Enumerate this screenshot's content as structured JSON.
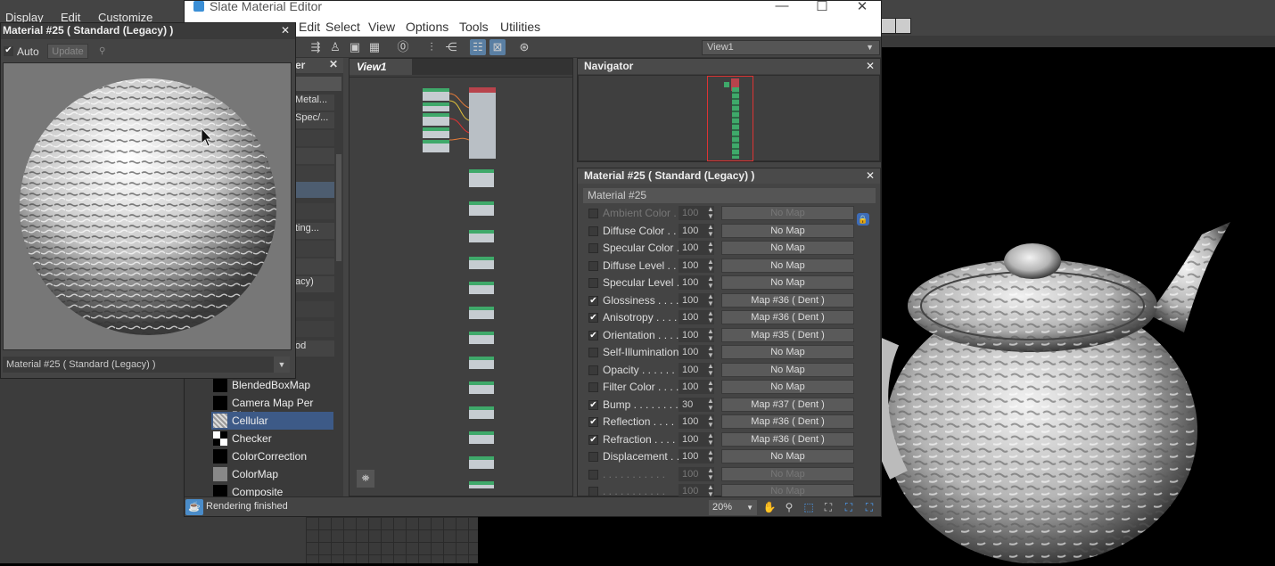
{
  "max": {
    "menu": [
      "Display",
      "Edit",
      "Customize"
    ]
  },
  "sme": {
    "title": "Slate Material Editor",
    "menu": [
      "Edit",
      "Select",
      "View",
      "Options",
      "Tools",
      "Utilities"
    ],
    "view_select": "View1",
    "browser": {
      "header": "er",
      "rows": [
        "Metal...",
        "Spec/...",
        "",
        "",
        "",
        "",
        "",
        "ting...",
        "",
        "acy)",
        "",
        "",
        "od",
        ""
      ],
      "maps": [
        {
          "name": "BlendedBoxMap",
          "swatch": "black"
        },
        {
          "name": "Camera Map Per Pixel",
          "swatch": "black"
        },
        {
          "name": "Cellular",
          "swatch": "cellular"
        },
        {
          "name": "Checker",
          "swatch": "checker"
        },
        {
          "name": "ColorCorrection",
          "swatch": "black"
        },
        {
          "name": "ColorMap",
          "swatch": "grey"
        },
        {
          "name": "Composite",
          "swatch": "black"
        }
      ]
    },
    "view1_tab": "View1",
    "navigator_title": "Navigator",
    "params_title": "Material #25  ( Standard (Legacy) )",
    "material_name": "Material #25",
    "params": [
      {
        "label": "Ambient Color . .",
        "checked": false,
        "amount": "100",
        "map": "No Map",
        "dim": true
      },
      {
        "label": "Diffuse Color . . .",
        "checked": false,
        "amount": "100",
        "map": "No Map",
        "dim": false
      },
      {
        "label": "Specular Color  .",
        "checked": false,
        "amount": "100",
        "map": "No Map",
        "dim": false
      },
      {
        "label": "Diffuse Level . . .",
        "checked": false,
        "amount": "100",
        "map": "No Map",
        "dim": false
      },
      {
        "label": "Specular Level  .",
        "checked": false,
        "amount": "100",
        "map": "No Map",
        "dim": false
      },
      {
        "label": "Glossiness  . . . .",
        "checked": true,
        "amount": "100",
        "map": "Map #36  ( Dent )",
        "dim": false
      },
      {
        "label": "Anisotropy  . . . .",
        "checked": true,
        "amount": "100",
        "map": "Map #36  ( Dent )",
        "dim": false
      },
      {
        "label": "Orientation . . . .",
        "checked": true,
        "amount": "100",
        "map": "Map #35  ( Dent )",
        "dim": false
      },
      {
        "label": "Self-Illumination .",
        "checked": false,
        "amount": "100",
        "map": "No Map",
        "dim": false
      },
      {
        "label": "Opacity . . . . . .",
        "checked": false,
        "amount": "100",
        "map": "No Map",
        "dim": false
      },
      {
        "label": "Filter Color  . . . .",
        "checked": false,
        "amount": "100",
        "map": "No Map",
        "dim": false
      },
      {
        "label": "Bump  . . . . . . . .",
        "checked": true,
        "amount": "30",
        "map": "Map #37  ( Dent )",
        "dim": false
      },
      {
        "label": "Reflection  . . . .",
        "checked": true,
        "amount": "100",
        "map": "Map #36  ( Dent )",
        "dim": false
      },
      {
        "label": "Refraction  . . . .",
        "checked": true,
        "amount": "100",
        "map": "Map #36  ( Dent )",
        "dim": false
      },
      {
        "label": "Displacement . . .",
        "checked": false,
        "amount": "100",
        "map": "No Map",
        "dim": false
      },
      {
        "label": ". . . . . . . . . . .",
        "checked": false,
        "amount": "100",
        "map": "No Map",
        "dim": true
      },
      {
        "label": ". . . . . . . . . . .",
        "checked": false,
        "amount": "100",
        "map": "No Map",
        "dim": true
      }
    ],
    "status": "Rendering finished",
    "zoom": "20%"
  },
  "preview": {
    "title": "Material #25  ( Standard (Legacy) )",
    "auto_label": "Auto",
    "auto_checked": true,
    "update_label": "Update",
    "bottom_select": "Material #25  ( Standard (Legacy) )"
  },
  "colors": {
    "accent_blue": "#3d5a87",
    "node_green": "#3fa96a",
    "material_red": "#b8434c"
  }
}
